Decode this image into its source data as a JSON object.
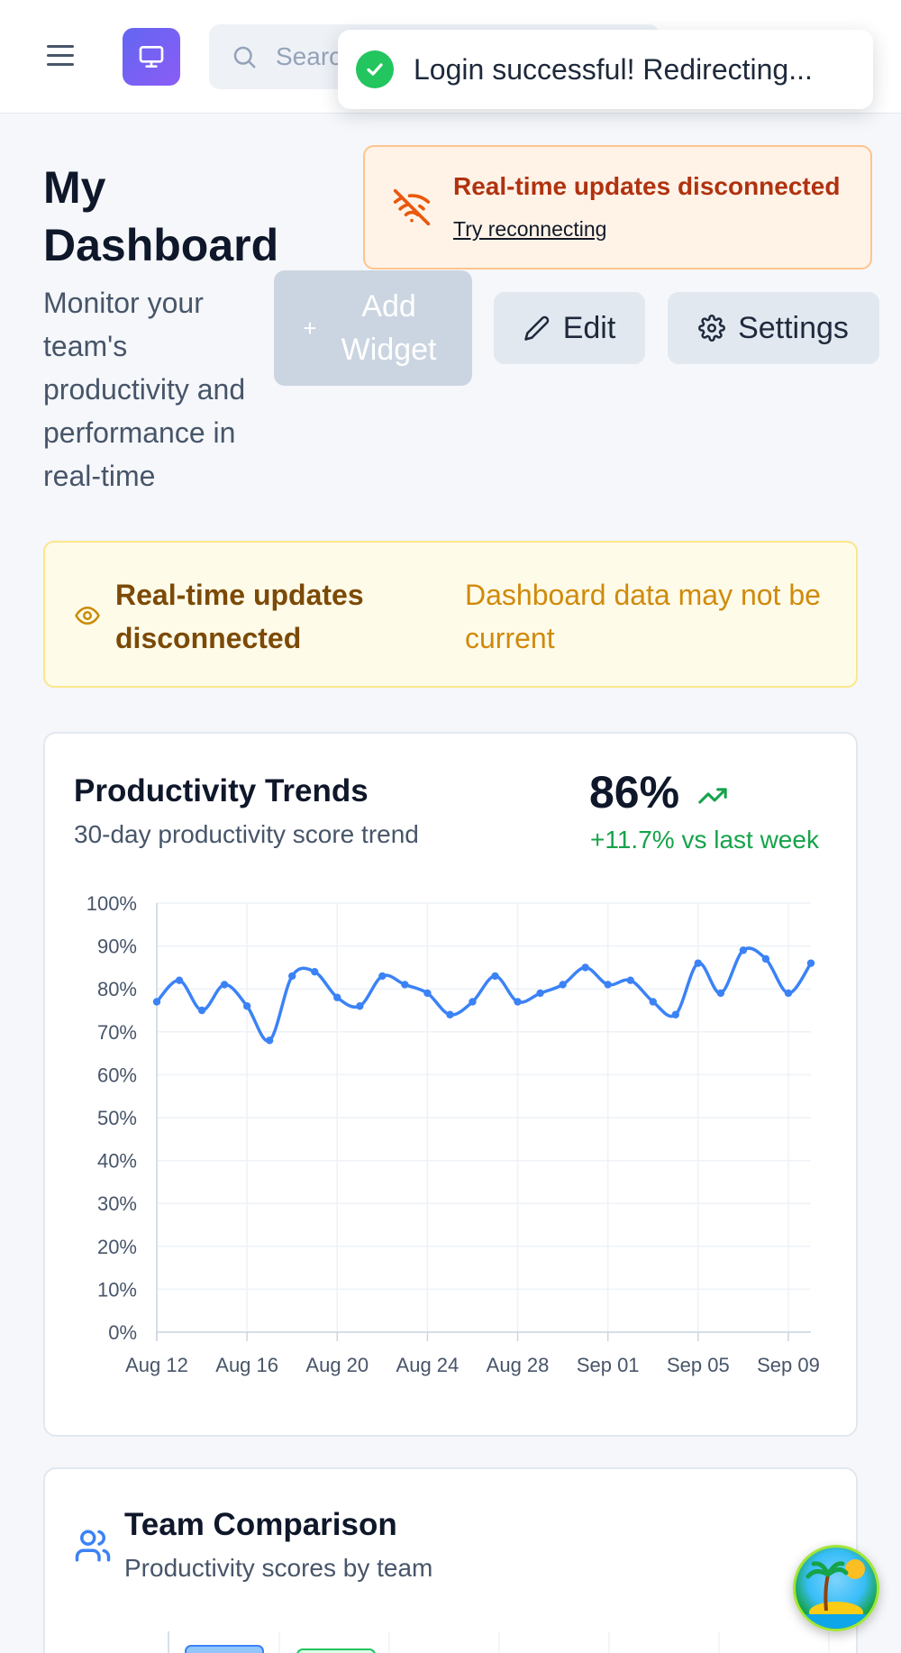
{
  "header": {
    "search_placeholder": "Search...",
    "icons": {
      "menu": "menu-icon",
      "logo": "monitor-icon",
      "search": "search-icon"
    }
  },
  "toast": {
    "message": "Login successful! Redirecting...",
    "icon": "check-circle-icon"
  },
  "realtime_alert": {
    "title": "Real-time updates disconnected",
    "action": "Try reconnecting",
    "icon": "wifi-off-icon"
  },
  "page": {
    "title": "My Dashboard",
    "subtitle": "Monitor your team's productivity and performance in real-time"
  },
  "actions": {
    "add_widget": "Add Widget",
    "add_widget_plus": "+",
    "edit": "Edit",
    "settings": "Settings"
  },
  "warning_banner": {
    "title": "Real-time updates disconnected",
    "message": "Dashboard data may not be current",
    "icon": "eye-icon"
  },
  "productivity_card": {
    "title": "Productivity Trends",
    "subtitle": "30-day productivity score trend",
    "value": "86%",
    "change": "+11.7% vs last week",
    "trend_icon": "trending-up-icon"
  },
  "chart_data": {
    "type": "line",
    "title": "Productivity Trends",
    "ylim": [
      0,
      100
    ],
    "y_ticks": [
      "0%",
      "10%",
      "20%",
      "30%",
      "40%",
      "50%",
      "60%",
      "70%",
      "80%",
      "90%",
      "100%"
    ],
    "x_ticks": [
      "Aug 12",
      "Aug 16",
      "Aug 20",
      "Aug 24",
      "Aug 28",
      "Sep 01",
      "Sep 05",
      "Sep 09"
    ],
    "grid": true,
    "x": [
      "Aug 12",
      "Aug 13",
      "Aug 14",
      "Aug 15",
      "Aug 16",
      "Aug 17",
      "Aug 18",
      "Aug 19",
      "Aug 20",
      "Aug 21",
      "Aug 22",
      "Aug 23",
      "Aug 24",
      "Aug 25",
      "Aug 26",
      "Aug 27",
      "Aug 28",
      "Aug 29",
      "Aug 30",
      "Sep 01",
      "Sep 02",
      "Sep 03",
      "Sep 04",
      "Sep 05",
      "Sep 06",
      "Sep 07",
      "Sep 08",
      "Sep 09",
      "Sep 10",
      "Sep 11"
    ],
    "series": [
      {
        "color": "#3b82f6",
        "values": [
          77,
          82,
          75,
          81,
          76,
          68,
          83,
          84,
          78,
          76,
          83,
          81,
          79,
          74,
          77,
          83,
          77,
          79,
          81,
          85,
          81,
          82,
          77,
          74,
          86,
          79,
          89,
          87,
          79,
          86
        ]
      }
    ]
  },
  "team_card": {
    "title": "Team Comparison",
    "subtitle": "Productivity scores by team",
    "icon": "users-icon"
  },
  "assistant_button": {
    "icon": "tropical-island-icon"
  }
}
